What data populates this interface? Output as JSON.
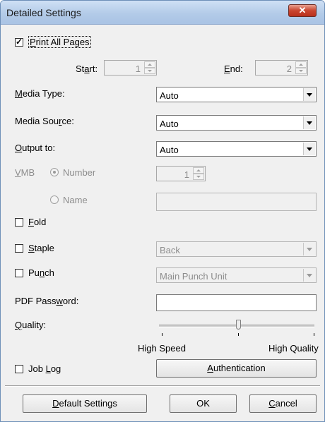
{
  "window": {
    "title": "Detailed Settings",
    "close_glyph": "✕"
  },
  "print_all_pages": {
    "checked": true,
    "label_pre": "",
    "label_key": "P",
    "label_post": "rint All Pages"
  },
  "range": {
    "start_label_pre": "St",
    "start_label_key": "a",
    "start_label_post": "rt:",
    "start_value": "1",
    "end_label_key": "E",
    "end_label_post": "nd:",
    "end_value": "2"
  },
  "media_type": {
    "label_key": "M",
    "label_post": "edia Type:",
    "value": "Auto"
  },
  "media_source": {
    "label_pre": "Media Sou",
    "label_key": "r",
    "label_post": "ce:",
    "value": "Auto"
  },
  "output_to": {
    "label_key": "O",
    "label_post": "utput to:",
    "value": "Auto"
  },
  "vmb": {
    "label_key": "V",
    "label_post": "MB",
    "number_label": "Number",
    "number_selected": true,
    "number_value": "1",
    "name_label": "Name",
    "name_value": ""
  },
  "fold": {
    "checked": false,
    "label_key": "F",
    "label_post": "old"
  },
  "staple": {
    "checked": false,
    "label_key": "S",
    "label_post": "taple",
    "value": "Back"
  },
  "punch": {
    "checked": false,
    "label_pre": "Pu",
    "label_key": "n",
    "label_post": "ch",
    "value": "Main Punch Unit"
  },
  "pdf_password": {
    "label_pre": "PDF Pass",
    "label_key": "w",
    "label_post": "ord:",
    "value": ""
  },
  "quality": {
    "label_key": "Q",
    "label_post": "uality:",
    "level": 0.5,
    "min_label": "High Speed",
    "max_label": "High Quality"
  },
  "job_log": {
    "checked": false,
    "label_pre": "Job ",
    "label_key": "L",
    "label_post": "og"
  },
  "authentication_button": {
    "label_key": "A",
    "label_post": "uthentication"
  },
  "footer": {
    "default_key": "D",
    "default_post": "efault Settings",
    "ok_label": "OK",
    "cancel_key": "C",
    "cancel_post": "ancel"
  }
}
